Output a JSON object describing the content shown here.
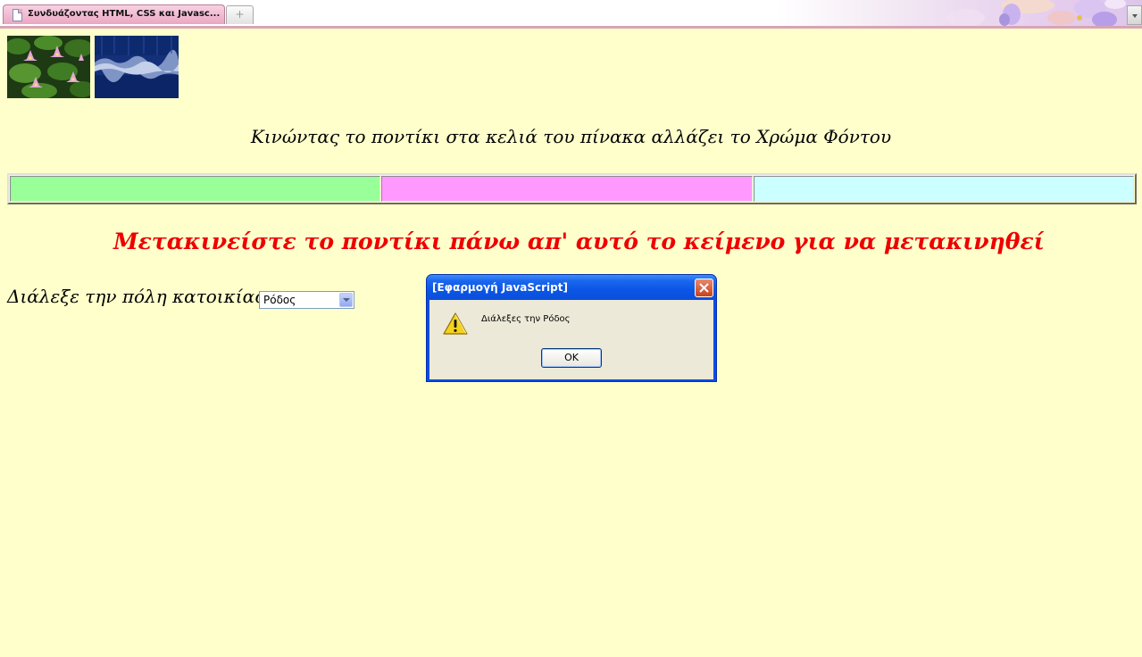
{
  "browser": {
    "tab_title": "Συνδυάζοντας HTML, CSS και Javasc...",
    "new_tab_symbol": "+"
  },
  "page": {
    "images": [
      {
        "icon": "water-lily-thumbnail"
      },
      {
        "icon": "blue-forest-thumbnail"
      }
    ],
    "instruction": "Κινώντας το ποντίκι στα κελιά του πίνακα αλλάζει το Χρώμα Φόντου",
    "color_cells": [
      "#99ff99",
      "#ff99ff",
      "#ccffff"
    ],
    "moving_text": "Μετακινείστε το ποντίκι πάνω απ' αυτό το κείμενο για να μετακινηθεί",
    "city_label": "Διάλεξε την πόλη κατοικίας σου",
    "city_selected": "Ρόδος"
  },
  "dialog": {
    "title": "[Εφαρμογή JavaScript]",
    "message": "Διάλεξες την Ρόδος",
    "ok_label": "OK",
    "icon": "warning-icon"
  }
}
